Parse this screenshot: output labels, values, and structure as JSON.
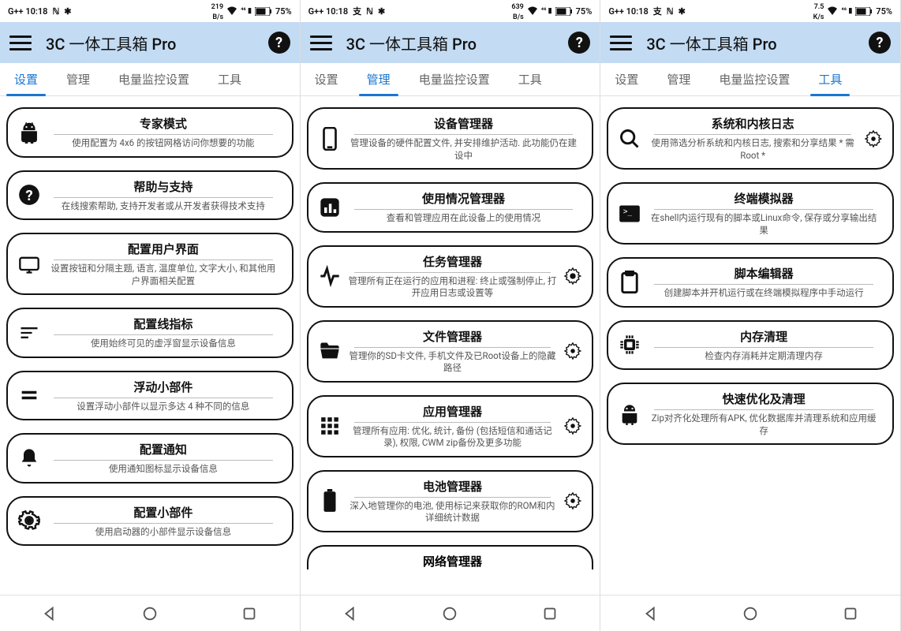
{
  "status": {
    "time": "G++ 10:18",
    "nfc": "ℕ",
    "bt": "✱",
    "net1": "219",
    "net1b": "B/s",
    "net2": "639",
    "net2b": "B/s",
    "net3": "7.5",
    "net3b": "K/s",
    "wifi": "⇅",
    "sig": "⁴⁶",
    "batt": "75%"
  },
  "header": {
    "title": "3C 一体工具箱 Pro"
  },
  "tabs": {
    "t0": "设置",
    "t1": "管理",
    "t2": "电量监控设置",
    "t3": "工具"
  },
  "s1": {
    "c0": {
      "t": "专家模式",
      "d": "使用配置为 4x6 的按钮网格访问你想要的功能"
    },
    "c1": {
      "t": "帮助与支持",
      "d": "在线搜索帮助, 支持开发者或从开发者获得技术支持"
    },
    "c2": {
      "t": "配置用户界面",
      "d": "设置按钮和分隔主题, 语言, 温度单位, 文字大小, 和其他用户界面相关配置"
    },
    "c3": {
      "t": "配置线指标",
      "d": "使用始终可见的虚浮窗显示设备信息"
    },
    "c4": {
      "t": "浮动小部件",
      "d": "设置浮动小部件以显示多达 4 种不同的信息"
    },
    "c5": {
      "t": "配置通知",
      "d": "使用通知图标显示设备信息"
    },
    "c6": {
      "t": "配置小部件",
      "d": "使用启动器的小部件显示设备信息"
    }
  },
  "s2": {
    "c0": {
      "t": "设备管理器",
      "d": "管理设备的硬件配置文件, 并安排维护活动. 此功能仍在建设中"
    },
    "c1": {
      "t": "使用情况管理器",
      "d": "查看和管理应用在此设备上的使用情况"
    },
    "c2": {
      "t": "任务管理器",
      "d": "管理所有正在运行的应用和进程: 终止或强制停止, 打开应用日志或设置等"
    },
    "c3": {
      "t": "文件管理器",
      "d": "管理你的SD卡文件, 手机文件及已Root设备上的隐藏路径"
    },
    "c4": {
      "t": "应用管理器",
      "d": "管理所有应用: 优化, 统计, 备份 (包括短信和通话记录), 权限, CWM zip备份及更多功能"
    },
    "c5": {
      "t": "电池管理器",
      "d": "深入地管理你的电池, 使用标记来获取你的ROM和内详细统计数据"
    },
    "c6": {
      "t": "网络管理器"
    }
  },
  "s3": {
    "c0": {
      "t": "系统和内核日志",
      "d": "使用筛选分析系统和内核日志, 搜索和分享结果 * 需Root *"
    },
    "c1": {
      "t": "终端模拟器",
      "d": "在shell内运行现有的脚本或Linux命令, 保存或分享输出结果"
    },
    "c2": {
      "t": "脚本编辑器",
      "d": "创建脚本并开机运行或在终端模拟程序中手动运行"
    },
    "c3": {
      "t": "内存清理",
      "d": "检查内存消耗并定期清理内存"
    },
    "c4": {
      "t": "快速优化及清理",
      "d": "Zip对齐化处理所有APK, 优化数据库并清理系统和应用缓存"
    }
  }
}
